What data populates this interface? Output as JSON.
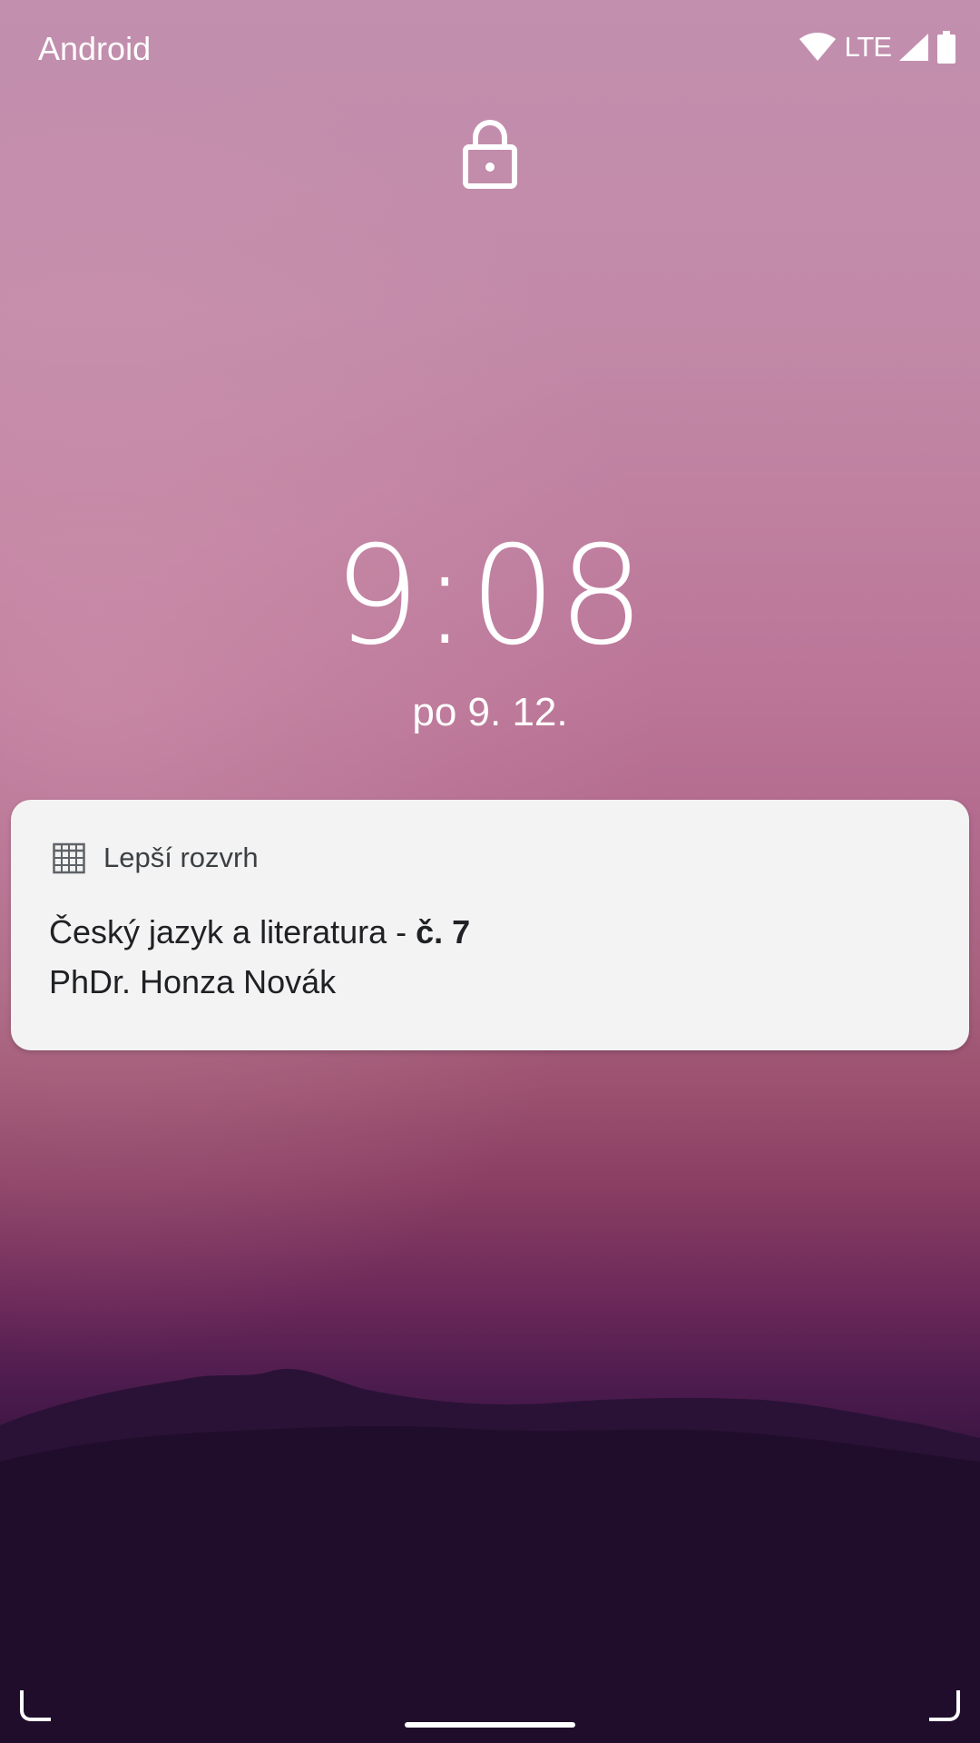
{
  "status_bar": {
    "carrier": "Android",
    "network_label": "LTE",
    "icons": [
      "wifi-icon",
      "signal-icon",
      "battery-icon"
    ]
  },
  "lock_screen": {
    "lock_icon": "lock-icon",
    "time": "9:08",
    "date": "po 9. 12."
  },
  "notification": {
    "app_icon": "calendar-grid-icon",
    "app_name": "Lepší rozvrh",
    "title_main": "Český jazyk a literatura - ",
    "title_bold": "č. 7",
    "text": "PhDr. Honza Novák"
  },
  "navigation": {
    "corner_icons": [
      "corner-left-icon",
      "corner-right-icon"
    ],
    "handle": "home-handle"
  },
  "colors": {
    "sky_top": "#c28fae",
    "sky_mid": "#b26a8d",
    "horizon": "#8a3f63",
    "ground": "#170822",
    "card_bg": "#f3f3f3",
    "card_text": "#202124"
  }
}
